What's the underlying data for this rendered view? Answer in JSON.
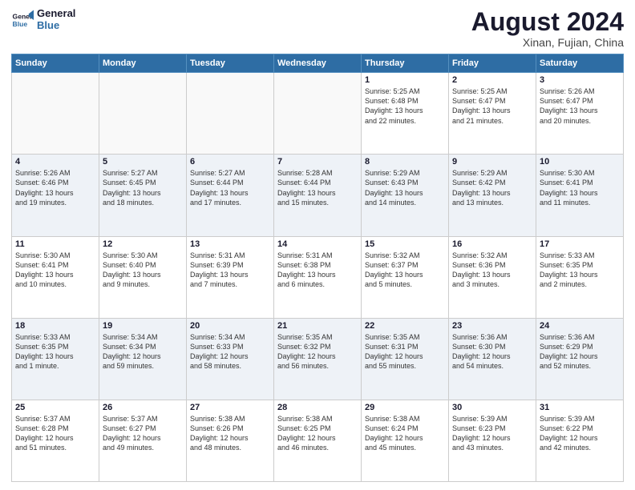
{
  "header": {
    "logo_line1": "General",
    "logo_line2": "Blue",
    "month_year": "August 2024",
    "location": "Xinan, Fujian, China"
  },
  "weekdays": [
    "Sunday",
    "Monday",
    "Tuesday",
    "Wednesday",
    "Thursday",
    "Friday",
    "Saturday"
  ],
  "weeks": [
    [
      {
        "day": "",
        "text": ""
      },
      {
        "day": "",
        "text": ""
      },
      {
        "day": "",
        "text": ""
      },
      {
        "day": "",
        "text": ""
      },
      {
        "day": "1",
        "text": "Sunrise: 5:25 AM\nSunset: 6:48 PM\nDaylight: 13 hours\nand 22 minutes."
      },
      {
        "day": "2",
        "text": "Sunrise: 5:25 AM\nSunset: 6:47 PM\nDaylight: 13 hours\nand 21 minutes."
      },
      {
        "day": "3",
        "text": "Sunrise: 5:26 AM\nSunset: 6:47 PM\nDaylight: 13 hours\nand 20 minutes."
      }
    ],
    [
      {
        "day": "4",
        "text": "Sunrise: 5:26 AM\nSunset: 6:46 PM\nDaylight: 13 hours\nand 19 minutes."
      },
      {
        "day": "5",
        "text": "Sunrise: 5:27 AM\nSunset: 6:45 PM\nDaylight: 13 hours\nand 18 minutes."
      },
      {
        "day": "6",
        "text": "Sunrise: 5:27 AM\nSunset: 6:44 PM\nDaylight: 13 hours\nand 17 minutes."
      },
      {
        "day": "7",
        "text": "Sunrise: 5:28 AM\nSunset: 6:44 PM\nDaylight: 13 hours\nand 15 minutes."
      },
      {
        "day": "8",
        "text": "Sunrise: 5:29 AM\nSunset: 6:43 PM\nDaylight: 13 hours\nand 14 minutes."
      },
      {
        "day": "9",
        "text": "Sunrise: 5:29 AM\nSunset: 6:42 PM\nDaylight: 13 hours\nand 13 minutes."
      },
      {
        "day": "10",
        "text": "Sunrise: 5:30 AM\nSunset: 6:41 PM\nDaylight: 13 hours\nand 11 minutes."
      }
    ],
    [
      {
        "day": "11",
        "text": "Sunrise: 5:30 AM\nSunset: 6:41 PM\nDaylight: 13 hours\nand 10 minutes."
      },
      {
        "day": "12",
        "text": "Sunrise: 5:30 AM\nSunset: 6:40 PM\nDaylight: 13 hours\nand 9 minutes."
      },
      {
        "day": "13",
        "text": "Sunrise: 5:31 AM\nSunset: 6:39 PM\nDaylight: 13 hours\nand 7 minutes."
      },
      {
        "day": "14",
        "text": "Sunrise: 5:31 AM\nSunset: 6:38 PM\nDaylight: 13 hours\nand 6 minutes."
      },
      {
        "day": "15",
        "text": "Sunrise: 5:32 AM\nSunset: 6:37 PM\nDaylight: 13 hours\nand 5 minutes."
      },
      {
        "day": "16",
        "text": "Sunrise: 5:32 AM\nSunset: 6:36 PM\nDaylight: 13 hours\nand 3 minutes."
      },
      {
        "day": "17",
        "text": "Sunrise: 5:33 AM\nSunset: 6:35 PM\nDaylight: 13 hours\nand 2 minutes."
      }
    ],
    [
      {
        "day": "18",
        "text": "Sunrise: 5:33 AM\nSunset: 6:35 PM\nDaylight: 13 hours\nand 1 minute."
      },
      {
        "day": "19",
        "text": "Sunrise: 5:34 AM\nSunset: 6:34 PM\nDaylight: 12 hours\nand 59 minutes."
      },
      {
        "day": "20",
        "text": "Sunrise: 5:34 AM\nSunset: 6:33 PM\nDaylight: 12 hours\nand 58 minutes."
      },
      {
        "day": "21",
        "text": "Sunrise: 5:35 AM\nSunset: 6:32 PM\nDaylight: 12 hours\nand 56 minutes."
      },
      {
        "day": "22",
        "text": "Sunrise: 5:35 AM\nSunset: 6:31 PM\nDaylight: 12 hours\nand 55 minutes."
      },
      {
        "day": "23",
        "text": "Sunrise: 5:36 AM\nSunset: 6:30 PM\nDaylight: 12 hours\nand 54 minutes."
      },
      {
        "day": "24",
        "text": "Sunrise: 5:36 AM\nSunset: 6:29 PM\nDaylight: 12 hours\nand 52 minutes."
      }
    ],
    [
      {
        "day": "25",
        "text": "Sunrise: 5:37 AM\nSunset: 6:28 PM\nDaylight: 12 hours\nand 51 minutes."
      },
      {
        "day": "26",
        "text": "Sunrise: 5:37 AM\nSunset: 6:27 PM\nDaylight: 12 hours\nand 49 minutes."
      },
      {
        "day": "27",
        "text": "Sunrise: 5:38 AM\nSunset: 6:26 PM\nDaylight: 12 hours\nand 48 minutes."
      },
      {
        "day": "28",
        "text": "Sunrise: 5:38 AM\nSunset: 6:25 PM\nDaylight: 12 hours\nand 46 minutes."
      },
      {
        "day": "29",
        "text": "Sunrise: 5:38 AM\nSunset: 6:24 PM\nDaylight: 12 hours\nand 45 minutes."
      },
      {
        "day": "30",
        "text": "Sunrise: 5:39 AM\nSunset: 6:23 PM\nDaylight: 12 hours\nand 43 minutes."
      },
      {
        "day": "31",
        "text": "Sunrise: 5:39 AM\nSunset: 6:22 PM\nDaylight: 12 hours\nand 42 minutes."
      }
    ]
  ]
}
